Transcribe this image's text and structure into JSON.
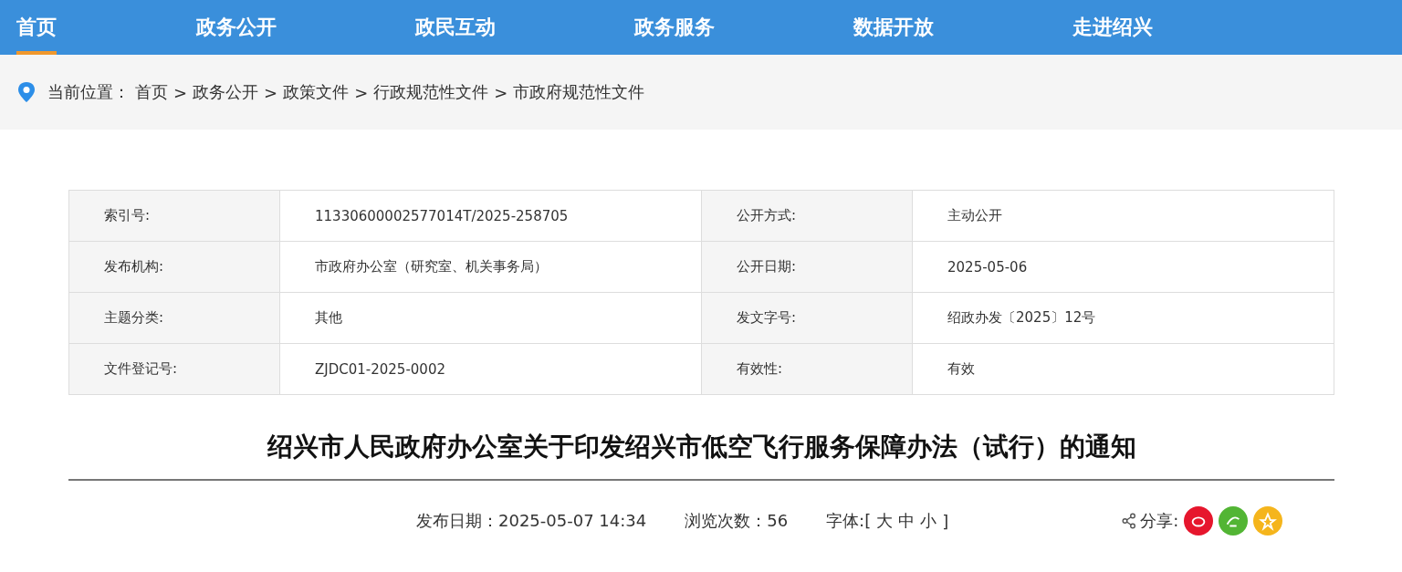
{
  "nav": [
    {
      "label": "首页",
      "selected": true
    },
    {
      "label": "政务公开",
      "selected": false
    },
    {
      "label": "政民互动",
      "selected": false
    },
    {
      "label": "政务服务",
      "selected": false
    },
    {
      "label": "数据开放",
      "selected": false
    },
    {
      "label": "走进绍兴",
      "selected": false
    }
  ],
  "breadcrumb": {
    "label": "当前位置：",
    "separator": ">",
    "items": [
      "首页",
      "政务公开",
      "政策文件",
      "行政规范性文件",
      "市政府规范性文件"
    ]
  },
  "info_table": [
    [
      {
        "label": "索引号:",
        "value": "11330600002577014T/2025-258705"
      },
      {
        "label": "公开方式:",
        "value": "主动公开"
      }
    ],
    [
      {
        "label": "发布机构:",
        "value": "市政府办公室（研究室、机关事务局）"
      },
      {
        "label": "公开日期:",
        "value": "2025-05-06"
      }
    ],
    [
      {
        "label": "主题分类:",
        "value": "其他"
      },
      {
        "label": "发文字号:",
        "value": "绍政办发〔2025〕12号"
      }
    ],
    [
      {
        "label": "文件登记号:",
        "value": "ZJDC01-2025-0002"
      },
      {
        "label": "有效性:",
        "value": "有效"
      }
    ]
  ],
  "title": "绍兴市人民政府办公室关于印发绍兴市低空飞行服务保障办法（试行）的通知",
  "meta": {
    "publish_date": "发布日期：2025-05-07 14:34",
    "views": "浏览次数：56",
    "font_size": {
      "open": "字体:[",
      "options": [
        "大",
        "中",
        "小"
      ],
      "close": "]"
    },
    "share": {
      "label": "分享:",
      "targets": [
        {
          "kind": "weibo",
          "color": "#e6162d"
        },
        {
          "kind": "wechat",
          "color": "#52b534"
        },
        {
          "kind": "qzone",
          "color": "#f5b51c"
        }
      ]
    }
  }
}
